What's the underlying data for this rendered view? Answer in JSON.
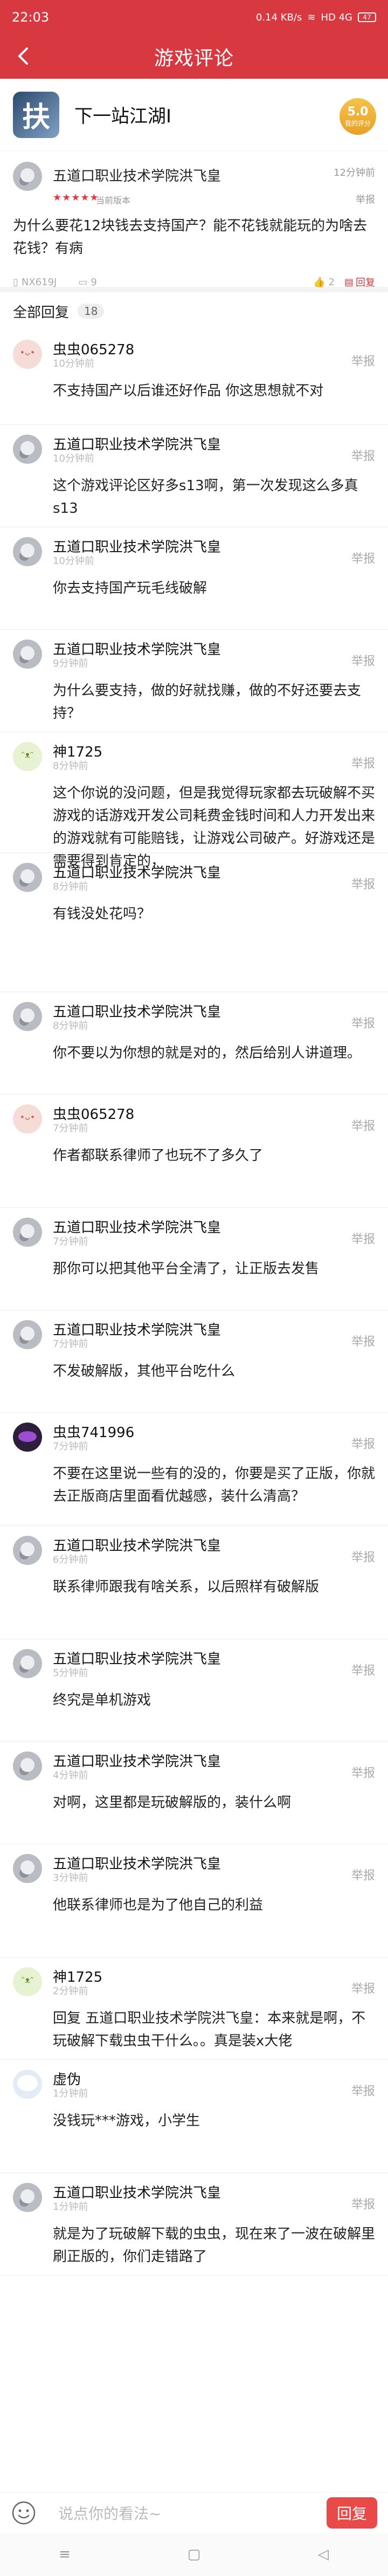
{
  "status": {
    "time": "22:03",
    "speed": "0.14\nKB/s",
    "network": "HD 4G",
    "battery": "47"
  },
  "header": {
    "title": "游戏评论"
  },
  "game": {
    "logo_char": "扶",
    "name": "下一站江湖Ⅰ",
    "score": "5.0",
    "score_label": "我的评分"
  },
  "review": {
    "author": "五道口职业技术学院洪飞皇",
    "time": "12分钟前",
    "stars": "★★★★★",
    "version": "当前版本",
    "report": "举报",
    "text": "为什么要花12块钱去支持国产？能不花钱就能玩的为啥去花钱？有病",
    "device": "NX619J",
    "comment_count": "9",
    "like_count": "2",
    "reply_label": "回复"
  },
  "replies_header": {
    "label": "全部回复",
    "count": "18"
  },
  "comments": [
    {
      "name": "虫虫065278",
      "time": "10分钟前",
      "text": "不支持国产以后谁还好作品 你这思想就不对",
      "report": "举报",
      "avatar": "pink"
    },
    {
      "name": "五道口职业技术学院洪飞皇",
      "time": "10分钟前",
      "text": "这个游戏评论区好多s13啊，第一次发现这么多真s13",
      "report": "举报",
      "avatar": "grey"
    },
    {
      "name": "五道口职业技术学院洪飞皇",
      "time": "10分钟前",
      "text": "你去支持国产玩毛线破解",
      "report": "举报",
      "avatar": "grey"
    },
    {
      "name": "五道口职业技术学院洪飞皇",
      "time": "9分钟前",
      "text": "为什么要支持，做的好就找赚，做的不好还要去支持？",
      "report": "举报",
      "avatar": "grey"
    },
    {
      "name": "神1725",
      "time": "8分钟前",
      "text": "这个你说的没问题，但是我觉得玩家都去玩破解不买游戏的话游戏开发公司耗费金钱时间和人力开发出来的游戏就有可能赔钱，让游戏公司破产。好游戏还是需要得到肯定的，",
      "report": "举报",
      "avatar": "green"
    },
    {
      "name": "五道口职业技术学院洪飞皇",
      "time": "8分钟前",
      "text": "有钱没处花吗？",
      "report": "举报",
      "avatar": "grey"
    },
    {
      "name": "五道口职业技术学院洪飞皇",
      "time": "8分钟前",
      "text": "你不要以为你想的就是对的，然后给别人讲道理。",
      "report": "举报",
      "avatar": "grey"
    },
    {
      "name": "虫虫065278",
      "time": "7分钟前",
      "text": "作者都联系律师了也玩不了多久了",
      "report": "举报",
      "avatar": "pink"
    },
    {
      "name": "五道口职业技术学院洪飞皇",
      "time": "7分钟前",
      "text": "那你可以把其他平台全清了，让正版去发售",
      "report": "举报",
      "avatar": "grey"
    },
    {
      "name": "五道口职业技术学院洪飞皇",
      "time": "7分钟前",
      "text": "不发破解版，其他平台吃什么",
      "report": "举报",
      "avatar": "grey"
    },
    {
      "name": "虫虫741996",
      "time": "7分钟前",
      "text": "不要在这里说一些有的没的，你要是买了正版，你就去正版商店里面看优越感，装什么清高？",
      "report": "举报",
      "avatar": "dark"
    },
    {
      "name": "五道口职业技术学院洪飞皇",
      "time": "6分钟前",
      "text": "联系律师跟我有啥关系，以后照样有破解版",
      "report": "举报",
      "avatar": "grey"
    },
    {
      "name": "五道口职业技术学院洪飞皇",
      "time": "5分钟前",
      "text": "终究是单机游戏",
      "report": "举报",
      "avatar": "grey"
    },
    {
      "name": "五道口职业技术学院洪飞皇",
      "time": "4分钟前",
      "text": "对啊，这里都是玩破解版的，装什么啊",
      "report": "举报",
      "avatar": "grey"
    },
    {
      "name": "五道口职业技术学院洪飞皇",
      "time": "3分钟前",
      "text": "他联系律师也是为了他自己的利益",
      "report": "举报",
      "avatar": "grey"
    },
    {
      "name": "神1725",
      "time": "2分钟前",
      "text": "回复 五道口职业技术学院洪飞皇：本来就是啊，不玩破解下载虫虫干什么。。真是装x大佬",
      "report": "举报",
      "avatar": "green"
    },
    {
      "name": "虚伪",
      "time": "1分钟前",
      "text": "没钱玩***游戏，小学生",
      "report": "举报",
      "avatar": "light"
    },
    {
      "name": "五道口职业技术学院洪飞皇",
      "time": "1分钟前",
      "text": "就是为了玩破解下载的虫虫，现在来了一波在破解里刷正版的，你们走错路了",
      "report": "举报",
      "avatar": "grey"
    }
  ],
  "composer": {
    "placeholder": "说点你的看法~",
    "send_label": "回复"
  }
}
